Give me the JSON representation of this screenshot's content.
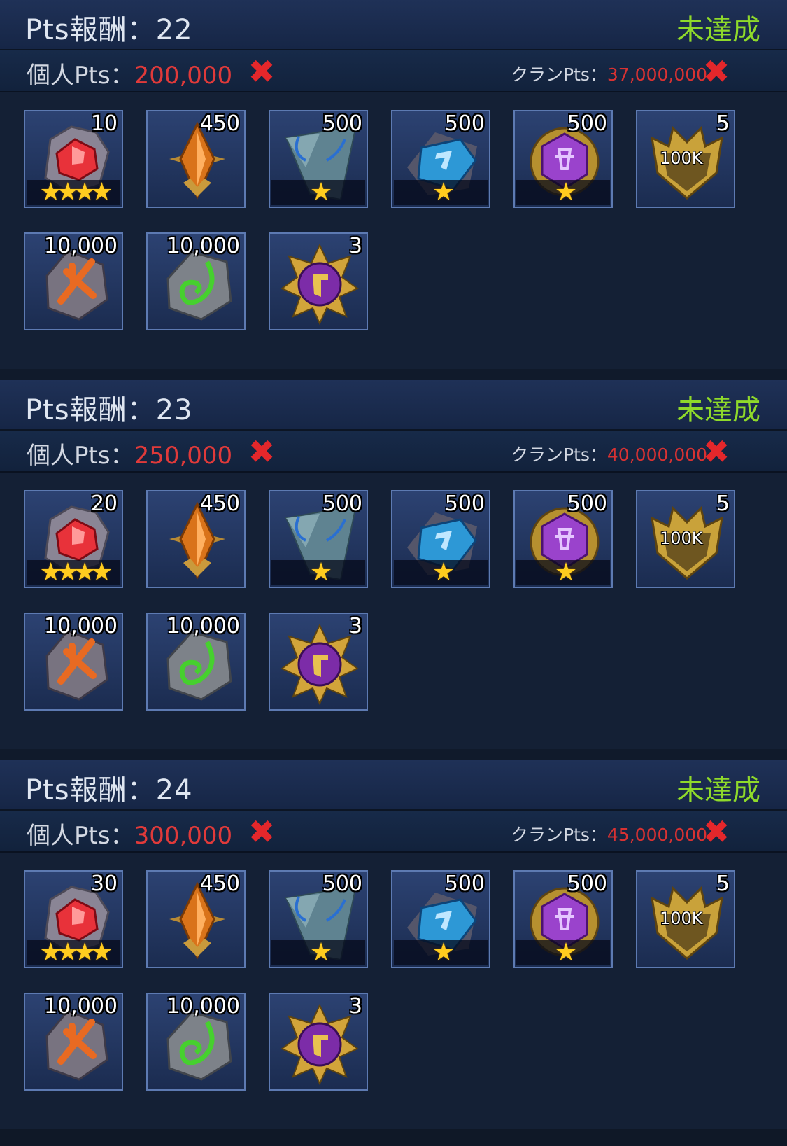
{
  "sections": [
    {
      "title": "Pts報酬：22",
      "status": "未達成",
      "personal_label": "個人Pts：",
      "personal_value": "200,000",
      "clan_label": "クランPts：",
      "clan_value": "37,000,000",
      "rewards": [
        "10",
        "450",
        "500",
        "500",
        "500",
        "5",
        "10,000",
        "10,000",
        "3"
      ]
    },
    {
      "title": "Pts報酬：23",
      "status": "未達成",
      "personal_label": "個人Pts：",
      "personal_value": "250,000",
      "clan_label": "クランPts：",
      "clan_value": "40,000,000",
      "rewards": [
        "20",
        "450",
        "500",
        "500",
        "500",
        "5",
        "10,000",
        "10,000",
        "3"
      ]
    },
    {
      "title": "Pts報酬：24",
      "status": "未達成",
      "personal_label": "個人Pts：",
      "personal_value": "300,000",
      "clan_label": "クランPts：",
      "clan_value": "45,000,000",
      "rewards": [
        "30",
        "450",
        "500",
        "500",
        "500",
        "5",
        "10,000",
        "10,000",
        "3"
      ]
    }
  ],
  "item_labels": {
    "badge_100k": "100K",
    "four_stars": "★★★★",
    "one_star": "★"
  },
  "icons": [
    "red-gem-icon",
    "orange-crystal-icon",
    "blue-stone-icon",
    "cyan-gem-icon",
    "purple-coin-icon",
    "gold-crest-icon",
    "orange-rune-icon",
    "green-rune-icon",
    "purple-medal-icon"
  ],
  "colors": {
    "status": "#8fda2a",
    "value": "#e03a3a",
    "x_mark": "#e4272b"
  }
}
